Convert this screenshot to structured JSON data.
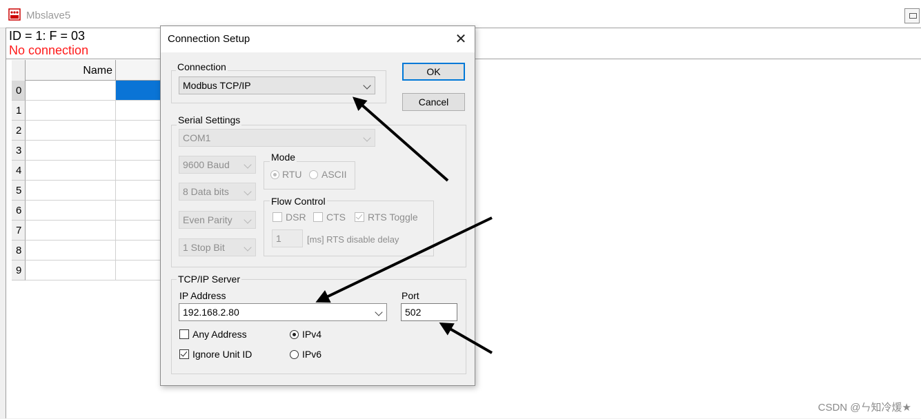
{
  "window": {
    "title": "Mbslave5",
    "info_line1": "ID = 1: F = 03",
    "info_line2": "No connection"
  },
  "grid": {
    "column_header": "Name",
    "row_numbers": [
      "0",
      "1",
      "2",
      "3",
      "4",
      "5",
      "6",
      "7",
      "8",
      "9"
    ]
  },
  "dialog": {
    "title": "Connection Setup",
    "close_glyph": "✕",
    "ok_label": "OK",
    "cancel_label": "Cancel",
    "connection": {
      "group_label": "Connection",
      "value": "Modbus TCP/IP"
    },
    "serial": {
      "group_label": "Serial Settings",
      "port": "COM1",
      "baud": "9600 Baud",
      "data_bits": "8 Data bits",
      "parity": "Even Parity",
      "stop_bit": "1 Stop Bit",
      "mode_label": "Mode",
      "mode_rtu": "RTU",
      "mode_ascii": "ASCII",
      "flow_label": "Flow Control",
      "dsr": "DSR",
      "cts": "CTS",
      "rts_toggle": "RTS Toggle",
      "rts_delay_value": "1",
      "rts_delay_label": "[ms] RTS disable delay"
    },
    "tcp": {
      "group_label": "TCP/IP Server",
      "ip_label": "IP Address",
      "ip_value": "192.168.2.80",
      "port_label": "Port",
      "port_value": "502",
      "any_address": "Any Address",
      "ignore_unit_id": "Ignore Unit ID",
      "ipv4": "IPv4",
      "ipv6": "IPv6"
    }
  },
  "watermark": "CSDN @ㄣ知冷煖★"
}
